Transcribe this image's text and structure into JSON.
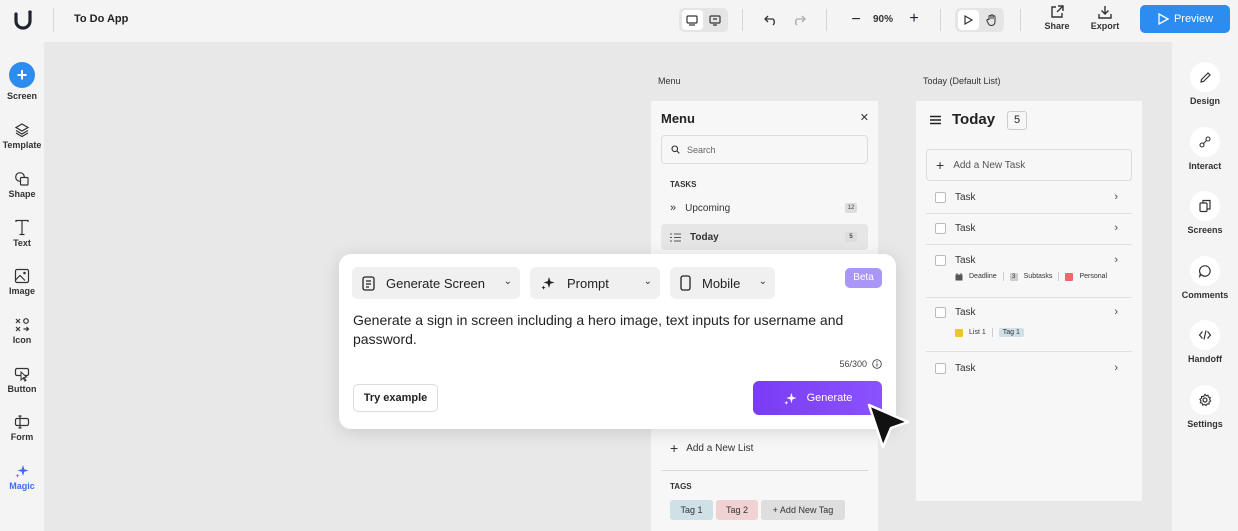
{
  "app": {
    "title": "To Do App"
  },
  "topbar": {
    "zoom": "90%",
    "share_label": "Share",
    "export_label": "Export",
    "preview_label": "Preview",
    "accent_color": "#2d8cf0"
  },
  "leftbar": {
    "items": [
      {
        "label": "Screen",
        "icon": "plus-icon"
      },
      {
        "label": "Template",
        "icon": "layers-icon"
      },
      {
        "label": "Shape",
        "icon": "shapes-icon"
      },
      {
        "label": "Text",
        "icon": "text-icon"
      },
      {
        "label": "Image",
        "icon": "image-icon"
      },
      {
        "label": "Icon",
        "icon": "icon-grid-icon"
      },
      {
        "label": "Button",
        "icon": "button-icon"
      },
      {
        "label": "Form",
        "icon": "form-icon"
      },
      {
        "label": "Magic",
        "icon": "sparkle-icon"
      }
    ]
  },
  "rightbar": {
    "items": [
      {
        "label": "Design",
        "icon": "pencil-icon"
      },
      {
        "label": "Interact",
        "icon": "interact-icon"
      },
      {
        "label": "Screens",
        "icon": "screens-icon"
      },
      {
        "label": "Comments",
        "icon": "comment-icon"
      },
      {
        "label": "Handoff",
        "icon": "code-icon"
      },
      {
        "label": "Settings",
        "icon": "gear-icon"
      }
    ]
  },
  "canvas": {
    "menu_screen_label": "Menu",
    "today_screen_label": "Today (Default List)"
  },
  "menu_screen": {
    "title": "Menu",
    "search_placeholder": "Search",
    "tasks_heading": "TASKS",
    "items": [
      {
        "label": "Upcoming",
        "count": "12"
      },
      {
        "label": "Today",
        "count": "5"
      }
    ],
    "add_list_label": "Add a New List",
    "tags_heading": "TAGS",
    "tags": [
      {
        "label": "Tag 1",
        "color": "#cfe0e6"
      },
      {
        "label": "Tag 2",
        "color": "#f0d2d2"
      },
      {
        "label": "+ Add New Tag",
        "color": "#dedede"
      }
    ]
  },
  "today_screen": {
    "title": "Today",
    "count": "5",
    "add_task_label": "Add a New Task",
    "tasks": [
      {
        "label": "Task"
      },
      {
        "label": "Task"
      },
      {
        "label": "Task",
        "deadline": "Deadline",
        "subtasks_count": "3",
        "subtasks": "Subtasks",
        "tag": "Personal"
      },
      {
        "label": "Task",
        "list": "List 1",
        "tag": "Tag 1"
      },
      {
        "label": "Task"
      }
    ]
  },
  "generator": {
    "mode": "Generate Screen",
    "input_type": "Prompt",
    "device": "Mobile",
    "badge": "Beta",
    "prompt_text": "Generate a sign in screen including a hero image, text inputs for username and password.",
    "char_count": "56/300",
    "try_example_label": "Try example",
    "generate_label": "Generate"
  }
}
